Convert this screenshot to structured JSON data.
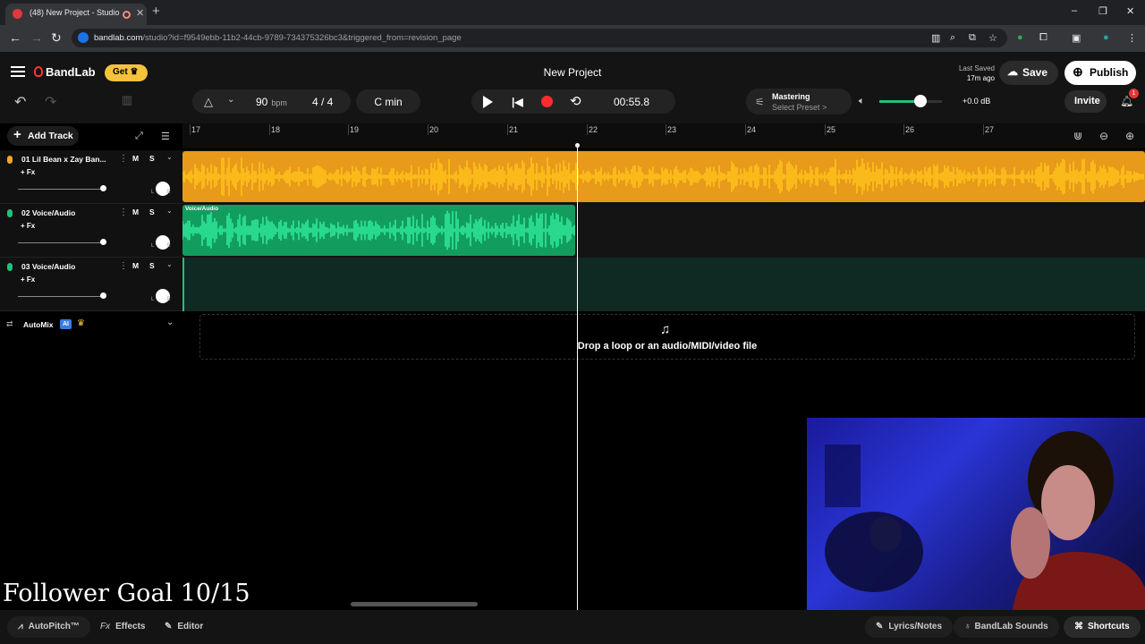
{
  "browser": {
    "tab_title": "(48) New Project - Studio",
    "url_domain": "bandlab.com",
    "url_path": "/studio?id=f9549ebb-11b2-44cb-9789-734375326bc3&triggered_from=revision_page",
    "window_controls": [
      "–",
      "❐",
      "✕"
    ]
  },
  "header": {
    "logo": "BandLab",
    "get_label": "Get",
    "project_title": "New Project",
    "last_saved_label": "Last Saved",
    "last_saved_time": "17m ago",
    "save_label": "Save",
    "publish_label": "Publish",
    "invite_label": "Invite",
    "notification_count": "1"
  },
  "transport": {
    "bpm_value": "90",
    "bpm_unit": "bpm",
    "time_signature": "4 / 4",
    "key": "C min",
    "time": "00:55.8",
    "mastering_label": "Mastering",
    "mastering_preset": "Select Preset >",
    "volume_db": "+0.0 dB",
    "volume_level": 0.65
  },
  "tracks_panel": {
    "add_track_label": "Add Track",
    "tracks": [
      {
        "name": "01  Lil Bean x Zay Ban...",
        "fx": "+ Fx",
        "mute": "M",
        "solo": "S",
        "color": "#f5a623",
        "clip_label": ""
      },
      {
        "name": "02  Voice/Audio",
        "fx": "+ Fx",
        "mute": "M",
        "solo": "S",
        "color": "#1ec27a",
        "clip_label": "Voice/Audio"
      },
      {
        "name": "03  Voice/Audio",
        "fx": "+ Fx",
        "mute": "M",
        "solo": "S",
        "color": "#1ec27a",
        "clip_label": ""
      }
    ],
    "automix_label": "AutoMix",
    "ai_badge": "AI"
  },
  "timeline": {
    "ruler": [
      "17",
      "18",
      "19",
      "20",
      "21",
      "22",
      "23",
      "24",
      "25",
      "26",
      "27"
    ],
    "drop_text": "Drop a loop or an audio/MIDI/video file"
  },
  "overlay": {
    "follower_goal": "Follower Goal 10/15"
  },
  "bottom_bar": {
    "autopitch": "AutoPitch™",
    "effects": "Effects",
    "editor": "Editor",
    "lyrics": "Lyrics/Notes",
    "sounds": "BandLab Sounds",
    "shortcuts": "Shortcuts"
  }
}
